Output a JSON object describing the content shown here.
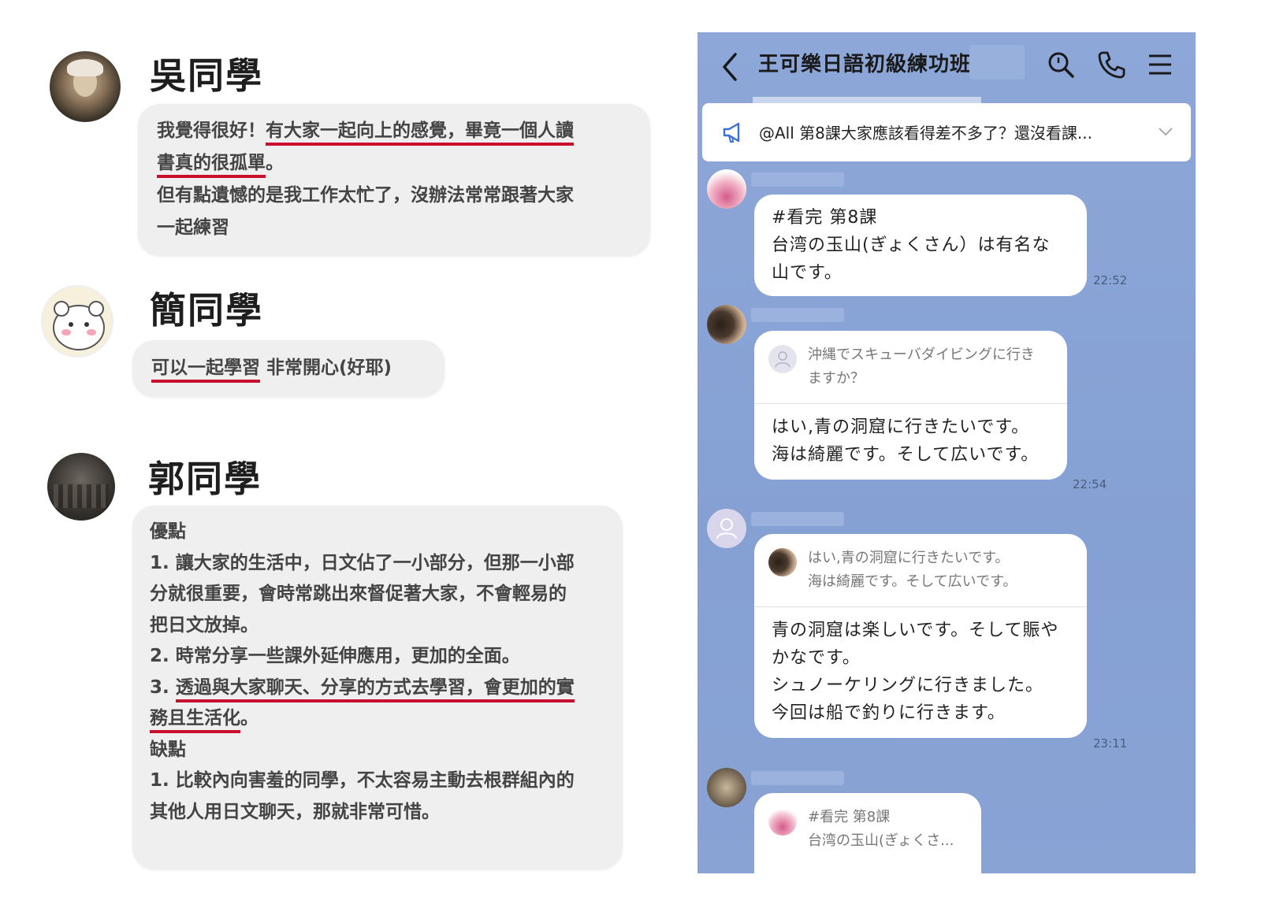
{
  "testimonials": [
    {
      "name": "吳同學",
      "lines": [
        {
          "pre": "我覺得很好！",
          "ul": "有大家一起向上的感覺，畢竟一個人讀"
        },
        {
          "pre": "",
          "ul": "書真的很孤單",
          "post": "。"
        },
        {
          "pre": "但有點遺憾的是我工作太忙了，沒辦法常常跟著大家",
          "ul": ""
        },
        {
          "pre": "一起練習",
          "ul": ""
        }
      ]
    },
    {
      "name": "簡同學",
      "lines": [
        {
          "pre": "",
          "ul": "可以一起學習",
          "post": " 非常開心(好耶)"
        }
      ]
    },
    {
      "name": "郭同學",
      "lines": [
        {
          "pre": "優點",
          "ul": ""
        },
        {
          "pre": "1. 讓大家的生活中，日文佔了一小部分，但那一小部",
          "ul": ""
        },
        {
          "pre": "分就很重要，會時常跳出來督促著大家，不會輕易的",
          "ul": ""
        },
        {
          "pre": "把日文放掉。",
          "ul": ""
        },
        {
          "pre": "2. 時常分享一些課外延伸應用，更加的全面。",
          "ul": ""
        },
        {
          "pre": "3. ",
          "ul": "透過與大家聊天、分享的方式去學習，會更加的實"
        },
        {
          "pre": "",
          "ul": "務且生活化",
          "post": "。"
        },
        {
          "pre": " ",
          "ul": ""
        },
        {
          "pre": "缺點",
          "ul": ""
        },
        {
          "pre": "1. 比較內向害羞的同學，不太容易主動去根群組內的",
          "ul": ""
        },
        {
          "pre": "其他人用日文聊天，那就非常可惜。",
          "ul": ""
        }
      ]
    }
  ],
  "chat": {
    "title": "王可樂日語初級練功班",
    "icons": [
      "back-icon",
      "search-icon",
      "phone-icon",
      "menu-icon"
    ],
    "announcement": "@All 第8課大家應該看得差不多了？還沒看課...",
    "messages": [
      {
        "lines": [
          "#看完 第8課",
          "台湾の玉山(ぎょくさん）は有名な",
          "山です。"
        ],
        "time": "22:52"
      },
      {
        "quote": [
          "沖縄でスキューバダイビングに行き",
          "ますか？"
        ],
        "lines": [
          "はい,青の洞窟に行きたいです。",
          "海は綺麗です。そして広いです。"
        ],
        "time": "22:54"
      },
      {
        "quote": [
          "はい,青の洞窟に行きたいです。",
          "海は綺麗です。そして広いです。"
        ],
        "lines": [
          "青の洞窟は楽しいです。そして賑や",
          "かなです。",
          "シュノーケリングに行きました。",
          "今回は船で釣りに行きます。"
        ],
        "time": "23:11"
      },
      {
        "quote": [
          "#看完 第8課",
          "台湾の玉山(ぎょくさ..."
        ]
      }
    ]
  },
  "colors": {
    "chat_bg": "#8aa5d6",
    "underline": "#c8102e",
    "bubble_left": "#f0efef"
  }
}
